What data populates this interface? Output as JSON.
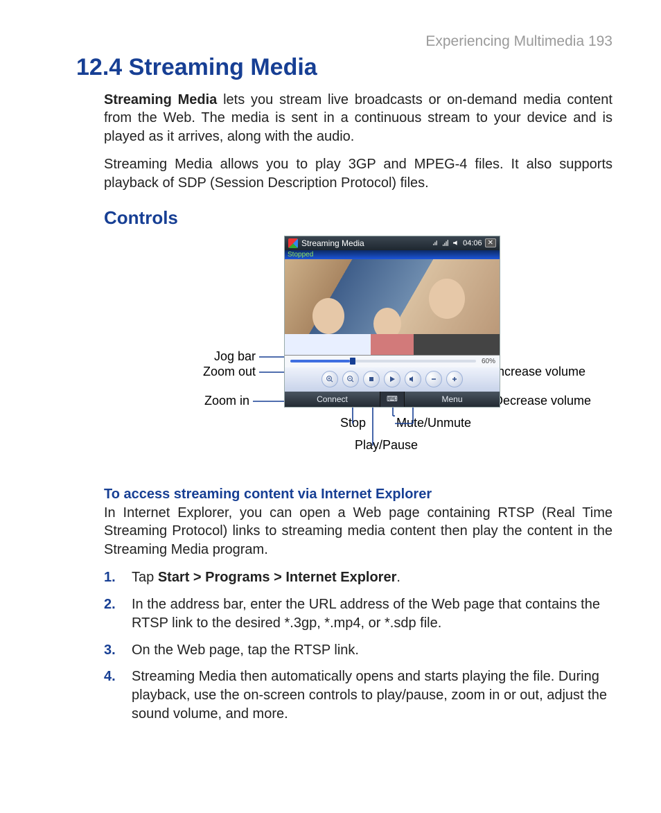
{
  "header": {
    "running": "Experiencing Multimedia  193"
  },
  "title": "12.4  Streaming Media",
  "intro": {
    "p1_lead": "Streaming Media",
    "p1_rest": " lets you stream live broadcasts or on-demand media content from the Web. The media is sent in a continuous stream to your device and is played as it arrives, along with the audio.",
    "p2": "Streaming Media allows you to play 3GP and MPEG-4 files. It also supports playback of SDP (Session Description Protocol) files."
  },
  "controls_heading": "Controls",
  "screenshot": {
    "app_title": "Streaming Media",
    "time": "04:06",
    "status_text": "Stopped",
    "progress_pct": "60%",
    "softkeys": {
      "left": "Connect",
      "right": "Menu",
      "mid_icon": "keyboard-icon"
    },
    "buttons": [
      "zoom-in",
      "zoom-out",
      "stop",
      "play-pause",
      "mute",
      "vol-down",
      "vol-up"
    ]
  },
  "callouts": {
    "jog_bar": "Jog bar",
    "zoom_out": "Zoom out",
    "zoom_in": "Zoom in",
    "stop": "Stop",
    "play_pause": "Play/Pause",
    "mute": "Mute/Unmute",
    "dec_vol": "Decrease volume",
    "inc_vol": "Increase volume"
  },
  "access": {
    "heading": "To access streaming content via Internet Explorer",
    "intro": "In Internet Explorer, you can open a Web page containing RTSP (Real Time Streaming Protocol) links to streaming media content then play the content in the Streaming Media program.",
    "steps": [
      {
        "pre": "Tap ",
        "bold": "Start > Programs > Internet Explorer",
        "post": "."
      },
      {
        "pre": "",
        "bold": "",
        "post": "In the address bar, enter the URL address of the Web page that contains the RTSP link to the desired *.3gp, *.mp4, or *.sdp file."
      },
      {
        "pre": "",
        "bold": "",
        "post": "On the Web page, tap the RTSP link."
      },
      {
        "pre": "",
        "bold": "",
        "post": "Streaming Media then automatically opens and starts playing the file. During playback, use the on-screen controls to play/pause, zoom in or out, adjust the sound volume, and more."
      }
    ]
  }
}
